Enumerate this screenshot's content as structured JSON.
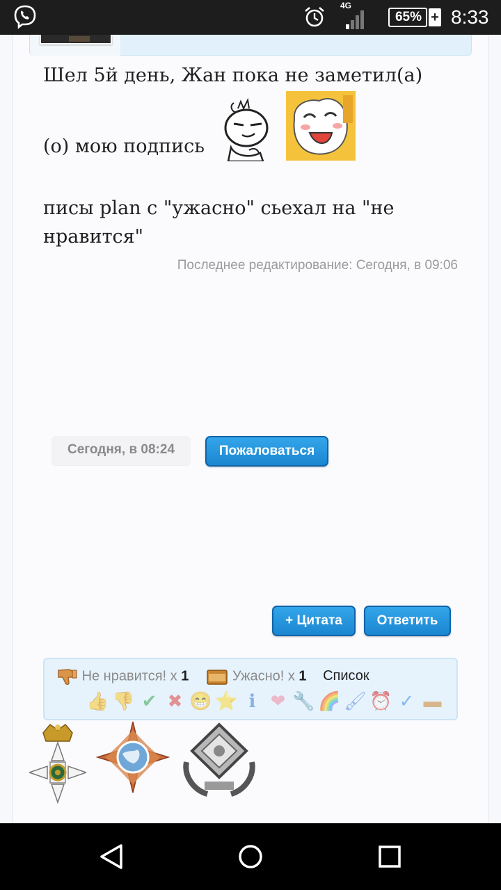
{
  "status_bar": {
    "network": "4G",
    "battery": "65%",
    "battery_charging_symbol": "+",
    "time": "8:33",
    "icons": [
      "viber-icon",
      "alarm-icon",
      "signal-icon",
      "battery-icon"
    ]
  },
  "post": {
    "line1": "Шел 5й день, Жан пока не заметил(а)",
    "line2": "(о) мою подпись",
    "line3": "писы plan с \"ужасно\" сьехал на \"не нравится\"",
    "edited_note": "Последнее редактирование: Сегодня, в 09:06",
    "date": "Сегодня, в 08:24",
    "report_label": "Пожаловаться",
    "quote_label": "+ Цитата",
    "reply_label": "Ответить"
  },
  "reactions": {
    "summary": [
      {
        "icon": "thumbs-down-icon",
        "label": "Не нравится! x",
        "count": "1"
      },
      {
        "icon": "box-icon",
        "label": "Ужасно! x",
        "count": "1"
      }
    ],
    "list_label": "Список",
    "available": [
      {
        "name": "like-icon",
        "glyph": "👍"
      },
      {
        "name": "dislike-icon",
        "glyph": "👎"
      },
      {
        "name": "agree-icon",
        "glyph": "✔"
      },
      {
        "name": "disagree-icon",
        "glyph": "✖"
      },
      {
        "name": "funny-icon",
        "glyph": "😁"
      },
      {
        "name": "winner-icon",
        "glyph": "⭐"
      },
      {
        "name": "informative-icon",
        "glyph": "ℹ"
      },
      {
        "name": "love-icon",
        "glyph": "❤"
      },
      {
        "name": "useful-icon",
        "glyph": "🔧"
      },
      {
        "name": "creative-icon",
        "glyph": "🌈"
      },
      {
        "name": "artistic-icon",
        "glyph": "🖌"
      },
      {
        "name": "late-icon",
        "glyph": "⏰"
      },
      {
        "name": "spelling-icon",
        "glyph": "✓"
      },
      {
        "name": "terrible-icon",
        "glyph": "▬"
      }
    ],
    "colors": {
      "box_bg": "#e6f3fc",
      "box_border": "#cbe4f6"
    }
  },
  "awards": [
    "order-cross-award-icon",
    "globe-star-award-icon",
    "silver-laurel-award-icon"
  ],
  "colors": {
    "button_blue": "#1b86d1",
    "page_bg": "#fbfbfe",
    "status_bar": "#1d1d1d"
  },
  "nav_bar": {
    "icons": [
      "back-icon",
      "home-icon",
      "recents-icon"
    ]
  }
}
